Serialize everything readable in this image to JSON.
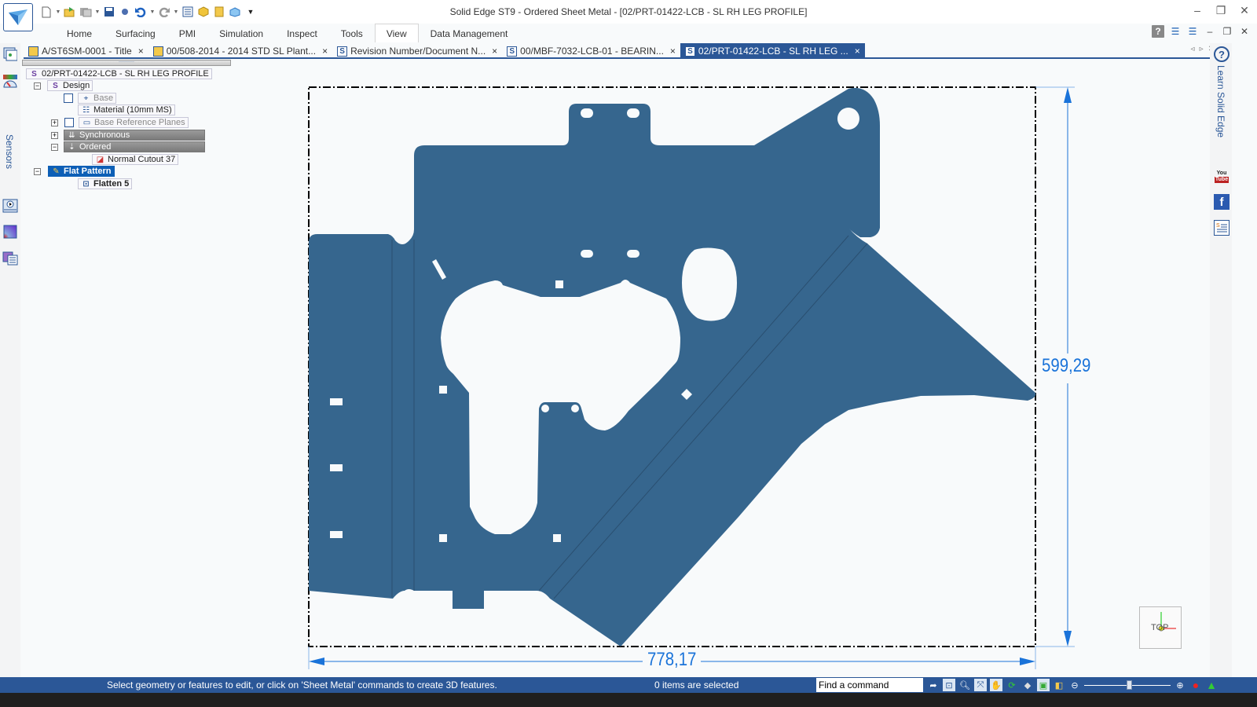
{
  "window": {
    "title": "Solid Edge ST9 - Ordered Sheet Metal - [02/PRT-01422-LCB - SL RH LEG PROFILE]",
    "controls": {
      "minimize": "–",
      "restore": "❐",
      "close": "✕"
    }
  },
  "quick_access": [
    {
      "name": "new-icon",
      "glyph": "🗋",
      "dropdown": true
    },
    {
      "name": "open-icon",
      "glyph": "📂",
      "dropdown": false
    },
    {
      "name": "save-all-icon",
      "glyph": "🖫",
      "dropdown": true
    },
    {
      "name": "save-icon",
      "glyph": "💾",
      "dropdown": false
    },
    {
      "name": "print-icon",
      "glyph": "●",
      "dropdown": false
    },
    {
      "name": "undo-icon",
      "glyph": "↶",
      "dropdown": true
    },
    {
      "name": "redo-icon",
      "glyph": "↷",
      "dropdown": true
    },
    {
      "name": "properties-icon",
      "glyph": "☰",
      "dropdown": false
    },
    {
      "name": "part-icon",
      "glyph": "◆",
      "dropdown": false
    },
    {
      "name": "sheetmetal-icon",
      "glyph": "◆",
      "dropdown": false
    },
    {
      "name": "assembly-icon",
      "glyph": "◈",
      "dropdown": false
    },
    {
      "name": "customize-icon",
      "glyph": "▾",
      "dropdown": false
    }
  ],
  "ribbon": {
    "tabs": [
      "Home",
      "Surfacing",
      "PMI",
      "Simulation",
      "Inspect",
      "Tools",
      "View",
      "Data Management"
    ],
    "active_tab": "View",
    "right_controls": {
      "help": "?",
      "arrange": "☰",
      "cascade": "☰",
      "minimize": "–",
      "restore": "❐",
      "close": "✕"
    }
  },
  "doc_tabs": [
    {
      "label": "A/ST6SM-0001 - Title",
      "icon": "draft",
      "active": false
    },
    {
      "label": "00/508-2014 - 2014 STD SL Plant...",
      "icon": "draft",
      "active": false
    },
    {
      "label": "Revision Number/Document N...",
      "icon": "sheetmetal",
      "active": false
    },
    {
      "label": "00/MBF-7032-LCB-01 - BEARIN...",
      "icon": "sheetmetal",
      "active": false
    },
    {
      "label": "02/PRT-01422-LCB - SL RH LEG ...",
      "icon": "sheetmetal",
      "active": true
    }
  ],
  "doc_tab_close": "×",
  "tab_nav": {
    "prev": "◃",
    "next": "▹",
    "close": "✕"
  },
  "left_strip": {
    "sensors_label": "Sensors"
  },
  "pathfinder": {
    "root": "02/PRT-01422-LCB - SL RH LEG PROFILE",
    "nodes": [
      {
        "label": "Design",
        "toggle": "−"
      },
      {
        "label": "Base",
        "checkbox": true
      },
      {
        "label": "Material (10mm MS)"
      },
      {
        "label": "Base Reference Planes",
        "toggle": "+",
        "checkbox": true
      },
      {
        "label": "Synchronous",
        "toggle": "+"
      },
      {
        "label": "Ordered",
        "toggle": "−"
      },
      {
        "label": "Normal Cutout 37"
      },
      {
        "label": "Flat Pattern",
        "toggle": "−",
        "selected": true
      },
      {
        "label": "Flatten 5"
      }
    ]
  },
  "drawing": {
    "part_color": "#36668e",
    "dimension_color": "#1a73d9",
    "dimensions": {
      "height": "599,29",
      "width": "778,17"
    }
  },
  "right_strip": {
    "learn_label": "Learn Solid Edge",
    "help_glyph": "?",
    "youtube": "You Tube",
    "facebook": "f"
  },
  "viewcube": {
    "label": "TOP"
  },
  "statusbar": {
    "prompt": "Select geometry or features to edit, or click on 'Sheet Metal' commands to create 3D features.",
    "selection": "0 items are selected",
    "find_command_value": "Find a command",
    "zoom_level_fraction": 0.52
  }
}
